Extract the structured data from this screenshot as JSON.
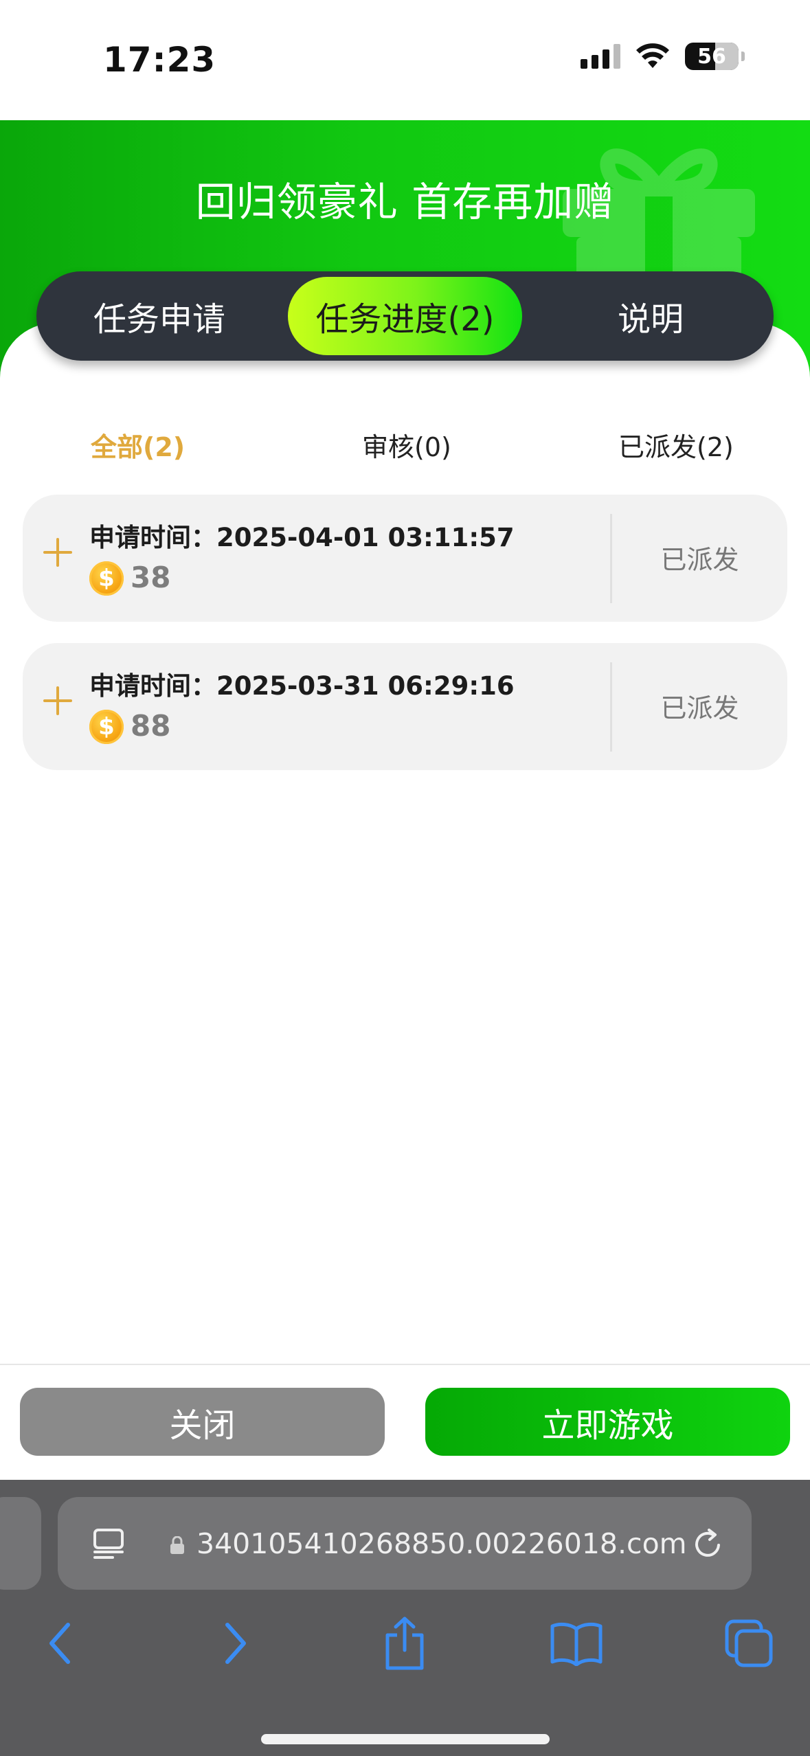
{
  "status_bar": {
    "time": "17:23",
    "battery": "56"
  },
  "header": {
    "title": "回归领豪礼 首存再加赠"
  },
  "tabs": [
    {
      "label": "任务申请"
    },
    {
      "label": "任务进度(2)"
    },
    {
      "label": "说明"
    }
  ],
  "filters": [
    {
      "label": "全部(2)"
    },
    {
      "label": "审核(0)"
    },
    {
      "label": "已派发(2)"
    }
  ],
  "records": [
    {
      "time_label": "申请时间：",
      "time": "2025-04-01 03:11:57",
      "coin_symbol": "$",
      "amount": "38",
      "status": "已派发"
    },
    {
      "time_label": "申请时间：",
      "time": "2025-03-31 06:29:16",
      "coin_symbol": "$",
      "amount": "88",
      "status": "已派发"
    }
  ],
  "buttons": {
    "close": "关闭",
    "play": "立即游戏"
  },
  "browser": {
    "url": "340105410268850.00226018.com"
  },
  "colors": {
    "brand_green": "#11c811",
    "accent_gold": "#e0a93d",
    "tab_bar_dark": "#2f343d"
  },
  "icons": [
    "signal-icon",
    "wifi-icon",
    "battery-icon",
    "gift-icon",
    "plus-icon",
    "coin-icon",
    "tab-overview-icon",
    "lock-icon",
    "reload-icon",
    "back-icon",
    "forward-icon",
    "share-icon",
    "bookmarks-icon",
    "tabs-icon"
  ]
}
